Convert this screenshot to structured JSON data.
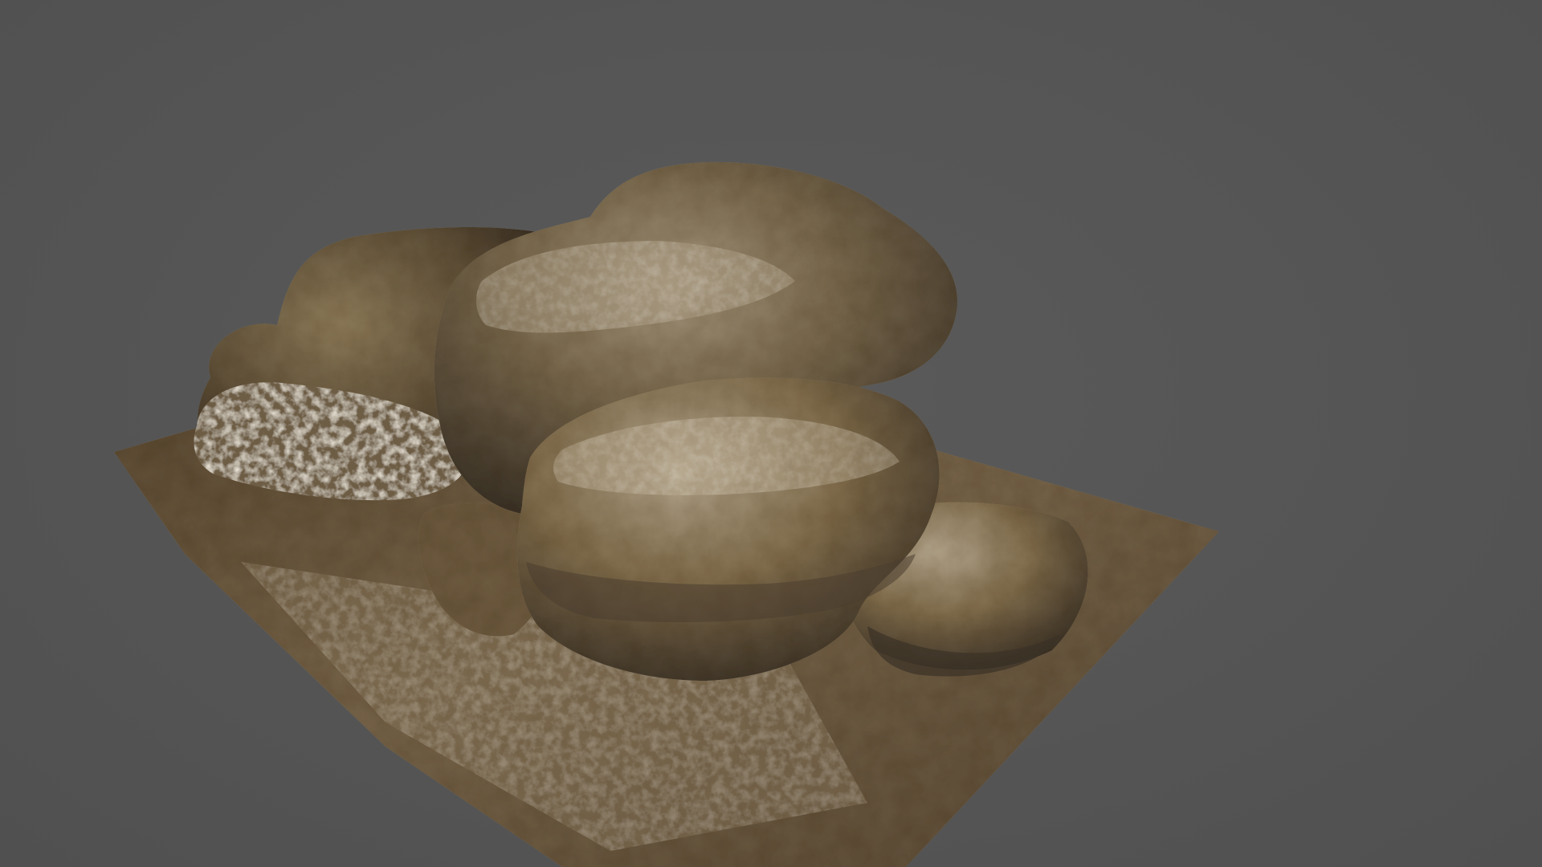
{
  "viewport": {
    "background_color": "#555555",
    "subject": "rock-formation-3d-model"
  },
  "palette": {
    "stone_light": "#b3a58c",
    "stone_mid": "#7d6c50",
    "stone_dark": "#3e352a",
    "moss_ochre": "#8a6a2a",
    "ground": "#6d5a3e",
    "ground_dark": "#4a3d2b",
    "slab_edge": "#3a3024"
  }
}
